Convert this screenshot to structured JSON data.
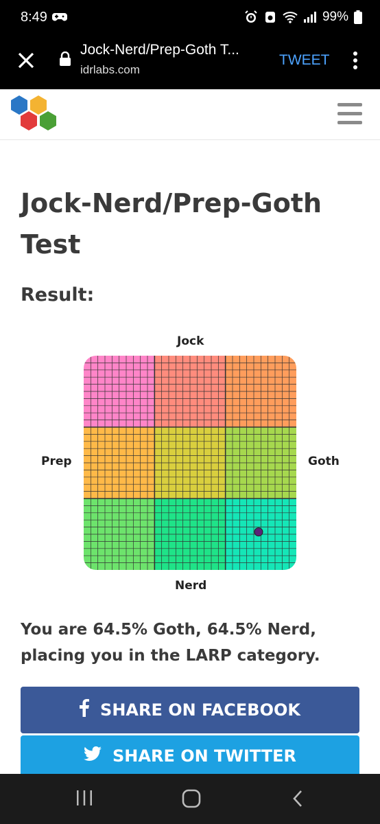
{
  "status": {
    "time": "8:49",
    "battery": "99%"
  },
  "browser": {
    "title": "Jock-Nerd/Prep-Goth T...",
    "domain": "idrlabs.com",
    "tweet_label": "TWEET"
  },
  "page": {
    "title": "Jock-Nerd/Prep-Goth Test",
    "result_label": "Result:",
    "result_text": "You are 64.5% Goth, 64.5% Nerd, placing you in the LARP category."
  },
  "chart_data": {
    "type": "scatter",
    "axes": {
      "top": "Jock",
      "bottom": "Nerd",
      "left": "Prep",
      "right": "Goth"
    },
    "point": {
      "goth_percent": 64.5,
      "nerd_percent": 64.5
    },
    "cells": [
      {
        "color": "#ff85c8"
      },
      {
        "color": "#ff8c7d"
      },
      {
        "color": "#ff9d5c"
      },
      {
        "color": "#ffb948"
      },
      {
        "color": "#d9cf3e"
      },
      {
        "color": "#a6d84e"
      },
      {
        "color": "#6de36c"
      },
      {
        "color": "#1fe388"
      },
      {
        "color": "#15e6b7"
      }
    ],
    "point_color": "#5b2378"
  },
  "share": {
    "facebook_label": "SHARE ON FACEBOOK",
    "twitter_label": "SHARE ON TWITTER"
  }
}
